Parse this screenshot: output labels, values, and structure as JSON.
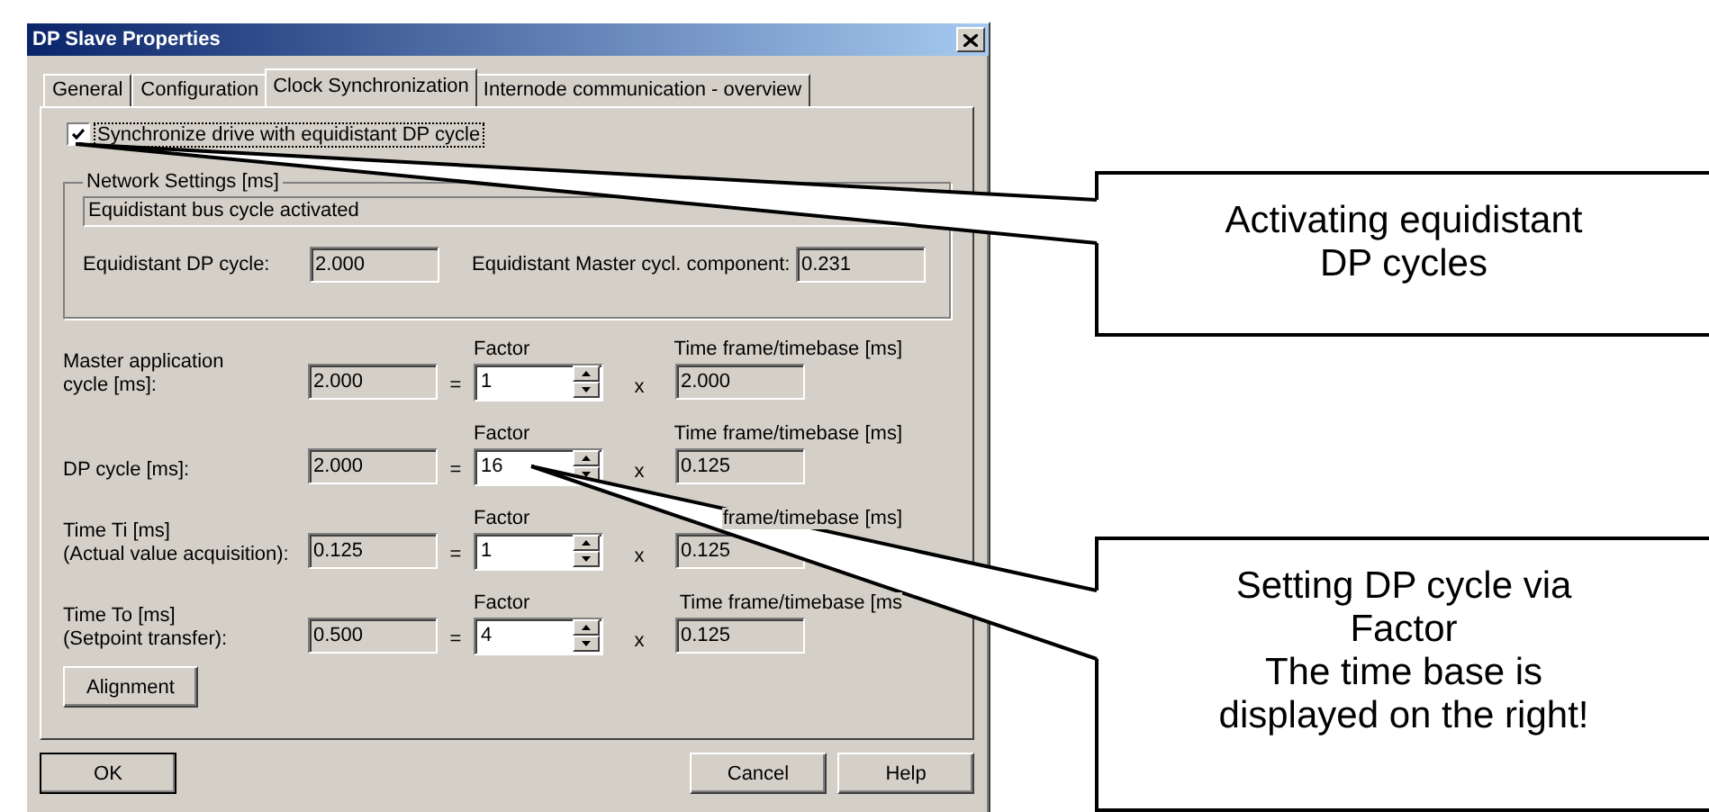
{
  "window": {
    "title": "DP Slave Properties"
  },
  "tabs": [
    {
      "label": "General",
      "selected": false
    },
    {
      "label": "Configuration",
      "selected": false
    },
    {
      "label": "Clock Synchronization",
      "selected": true
    },
    {
      "label": "Internode communication - overview",
      "selected": false
    }
  ],
  "sync_checkbox": {
    "label": "Synchronize drive with equidistant DP cycle",
    "checked": true
  },
  "network_settings": {
    "title": "Network Settings [ms]",
    "status": "Equidistant bus cycle activated",
    "fields": [
      {
        "label": "Equidistant DP cycle:",
        "value": "2.000"
      },
      {
        "label": "Equidistant Master cycl. component:",
        "value": "0.231"
      }
    ]
  },
  "rows": [
    {
      "label_lines": [
        "Master application",
        "cycle [ms]:"
      ],
      "value": "2.000",
      "equals": "=",
      "factor_label": "Factor",
      "factor": "1",
      "times": "x",
      "timebase_label": "Time frame/timebase [ms]",
      "timebase": "2.000"
    },
    {
      "label_lines": [
        "DP cycle [ms]:"
      ],
      "value": "2.000",
      "equals": "=",
      "factor_label": "Factor",
      "factor": "16",
      "times": "x",
      "timebase_label": "Time frame/timebase [ms]",
      "timebase": "0.125"
    },
    {
      "label_lines": [
        "Time Ti [ms]",
        "(Actual value acquisition):"
      ],
      "value": "0.125",
      "equals": "=",
      "factor_label": "Factor",
      "factor": "1",
      "times": "x",
      "timebase_label": "frame/timebase [ms]",
      "timebase": "0.125"
    },
    {
      "label_lines": [
        "Time To [ms]",
        "(Setpoint transfer):"
      ],
      "value": "0.500",
      "equals": "=",
      "factor_label": "Factor",
      "factor": "4",
      "times": "x",
      "timebase_label": "Time frame/timebase [ms",
      "timebase": "0.125"
    }
  ],
  "alignment_button": "Alignment",
  "buttons": {
    "ok": "OK",
    "cancel": "Cancel",
    "help": "Help"
  },
  "callouts": [
    {
      "lines": [
        "Activating equidistant",
        "DP cycles"
      ]
    },
    {
      "lines": [
        "Setting DP cycle via",
        "Factor",
        "The time base is",
        "displayed on the right!"
      ]
    }
  ]
}
